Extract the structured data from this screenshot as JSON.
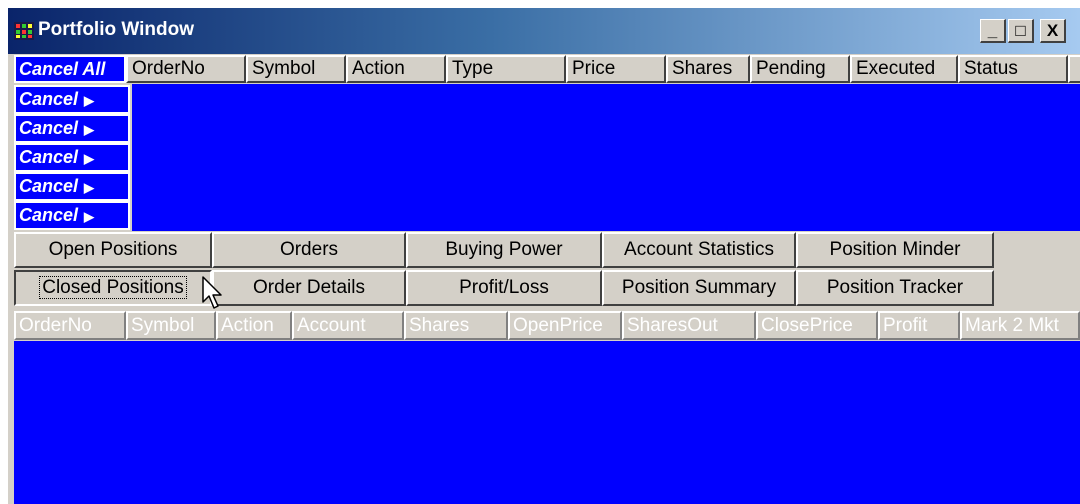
{
  "window": {
    "title": "Portfolio Window",
    "controls": {
      "minimize": "_",
      "maximize": "□",
      "close": "X"
    }
  },
  "orders": {
    "cancel_all_label": "Cancel All",
    "columns": [
      "OrderNo",
      "Symbol",
      "Action",
      "Type",
      "Price",
      "Shares",
      "Pending",
      "Executed",
      "Status",
      ""
    ],
    "cancel_rows": [
      "Cancel",
      "Cancel",
      "Cancel",
      "Cancel",
      "Cancel"
    ],
    "area_color": "#0000ff"
  },
  "tabs": {
    "row1": [
      "Open Positions",
      "Orders",
      "Buying Power",
      "Account Statistics",
      "Position Minder"
    ],
    "row2": [
      "Closed Positions",
      "Order Details",
      "Profit/Loss",
      "Position Summary",
      "Position Tracker"
    ],
    "selected": "Closed Positions"
  },
  "positions": {
    "columns": [
      "OrderNo",
      "Symbol",
      "Action",
      "Account",
      "Shares",
      "OpenPrice",
      "SharesOut",
      "ClosePrice",
      "Profit",
      "Mark 2 Mkt"
    ],
    "area_color": "#0000ff"
  },
  "colors": {
    "title_start": "#0a246a",
    "title_end": "#a6caf0",
    "face": "#d4d0c8",
    "grid_blue": "#0000ff"
  }
}
